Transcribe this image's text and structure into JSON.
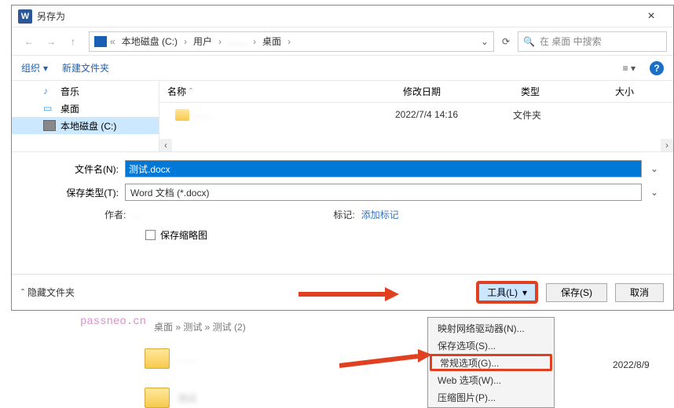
{
  "titlebar": {
    "title": "另存为"
  },
  "breadcrumb": {
    "seg_disk": "本地磁盘 (C:)",
    "seg_users": "用户",
    "seg_blur": "……",
    "seg_desktop": "桌面"
  },
  "search": {
    "placeholder": "在 桌面 中搜索"
  },
  "toolbar": {
    "organize": "组织",
    "new_folder": "新建文件夹"
  },
  "columns": {
    "name": "名称",
    "date": "修改日期",
    "type": "类型",
    "size": "大小"
  },
  "sidebar": {
    "music": "音乐",
    "desktop": "桌面",
    "local_disk": "本地磁盘 (C:)"
  },
  "file_rows": [
    {
      "name_blur": "……",
      "date": "2022/7/4 14:16",
      "type": "文件夹"
    }
  ],
  "form": {
    "filename_label": "文件名(N):",
    "filename_value": "测试.docx",
    "filetype_label": "保存类型(T):",
    "filetype_value": "Word 文档 (*.docx)"
  },
  "meta": {
    "author_label": "作者:",
    "tags_label": "标记:",
    "tags_value": "添加标记"
  },
  "thumb": {
    "label": "保存缩略图"
  },
  "footer": {
    "hide_folders": "隐藏文件夹",
    "tools": "工具(L)",
    "save": "保存(S)",
    "cancel": "取消"
  },
  "menu": {
    "map_drive": "映射网络驱动器(N)...",
    "save_options": "保存选项(S)...",
    "general_options": "常规选项(G)...",
    "web_options": "Web 选项(W)...",
    "compress_pics": "压缩图片(P)..."
  },
  "bg": {
    "crumb": "桌面 » 测试 » 测试 (2)",
    "date": "2022/8/9",
    "row_blur": "测试",
    "watermark": "passneo.cn"
  }
}
